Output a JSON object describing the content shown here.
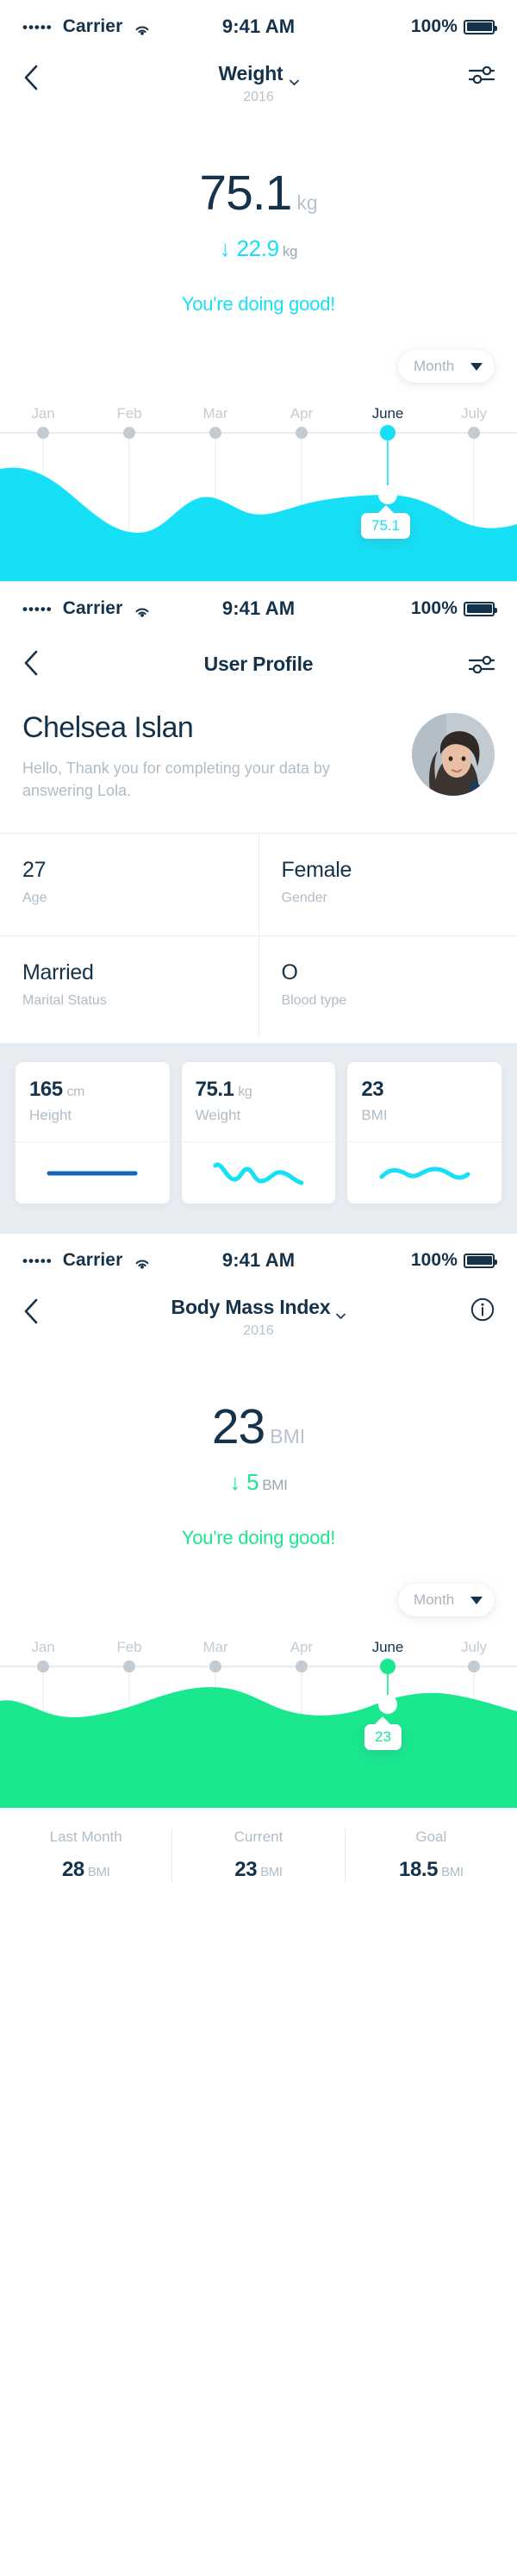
{
  "theme": {
    "ink": "#15324b",
    "muted": "#b0bcc6",
    "cyan": "#16e0f5",
    "green": "#19e88e",
    "blue": "#1565c0",
    "card_bg": "#e8edf2"
  },
  "statusbar": {
    "signal_dots": "•••••",
    "carrier": "Carrier",
    "wifi_icon": "wifi-icon",
    "time": "9:41 AM",
    "battery_percent": "100%",
    "battery_icon": "battery-full-icon"
  },
  "screen_weight": {
    "nav": {
      "back_icon": "chevron-left-icon",
      "title": "Weight",
      "title_chevron_icon": "chevron-down-icon",
      "subtitle": "2016",
      "action_icon": "sliders-icon"
    },
    "hero": {
      "value": "75.1",
      "unit": "kg",
      "delta_arrow": "↓",
      "delta_value": "22.9",
      "delta_unit": "kg",
      "message": "You're doing good!"
    },
    "range_selector": {
      "label": "Month",
      "caret_icon": "caret-down-icon"
    },
    "chart_data": {
      "type": "area",
      "title": "Weight",
      "unit": "kg",
      "categories": [
        "Jan",
        "Feb",
        "Mar",
        "Apr",
        "June",
        "July"
      ],
      "values": [
        84,
        69,
        72,
        74,
        75.1,
        71
      ],
      "active_category": "June",
      "active_value": "75.1",
      "tooltip": "75.1",
      "color": "#16e0f5",
      "grid": true,
      "legend": "none",
      "xlabel": "",
      "ylabel": "kg"
    }
  },
  "screen_profile": {
    "nav": {
      "back_icon": "chevron-left-icon",
      "title": "User Profile",
      "action_icon": "sliders-icon"
    },
    "name": "Chelsea Islan",
    "greeting": "Hello, Thank you for completing your data by answering Lola.",
    "avatar_icon": "avatar",
    "info": [
      {
        "value": "27",
        "label": "Age"
      },
      {
        "value": "Female",
        "label": "Gender"
      },
      {
        "value": "Married",
        "label": "Marital Status"
      },
      {
        "value": "O",
        "label": "Blood type"
      }
    ],
    "cards": [
      {
        "value": "165",
        "unit": "cm",
        "label": "Height",
        "spark": "flat",
        "color": "#1565c0"
      },
      {
        "value": "75.1",
        "unit": "kg",
        "label": "Weight",
        "spark": "wavy",
        "color": "#16e0f5"
      },
      {
        "value": "23",
        "unit": "",
        "label": "BMI",
        "spark": "wavy2",
        "color": "#16e0f5"
      }
    ]
  },
  "screen_bmi": {
    "nav": {
      "back_icon": "chevron-left-icon",
      "title": "Body Mass Index",
      "title_chevron_icon": "chevron-down-icon",
      "subtitle": "2016",
      "action_icon": "info-circle-icon"
    },
    "hero": {
      "value": "23",
      "unit": "BMI",
      "delta_arrow": "↓",
      "delta_value": "5",
      "delta_unit": "BMI",
      "message": "You're doing good!"
    },
    "range_selector": {
      "label": "Month",
      "caret_icon": "caret-down-icon"
    },
    "chart_data": {
      "type": "area",
      "title": "Body Mass Index",
      "unit": "BMI",
      "categories": [
        "Jan",
        "Feb",
        "Mar",
        "Apr",
        "June",
        "July"
      ],
      "values": [
        26,
        24,
        28,
        25,
        23,
        27
      ],
      "active_category": "June",
      "active_value": "23",
      "tooltip": "23",
      "color": "#19e88e",
      "grid": true,
      "legend": "none",
      "xlabel": "",
      "ylabel": "BMI"
    },
    "stats": [
      {
        "label": "Last Month",
        "value": "28",
        "unit": "BMI"
      },
      {
        "label": "Current",
        "value": "23",
        "unit": "BMI"
      },
      {
        "label": "Goal",
        "value": "18.5",
        "unit": "BMI"
      }
    ]
  }
}
